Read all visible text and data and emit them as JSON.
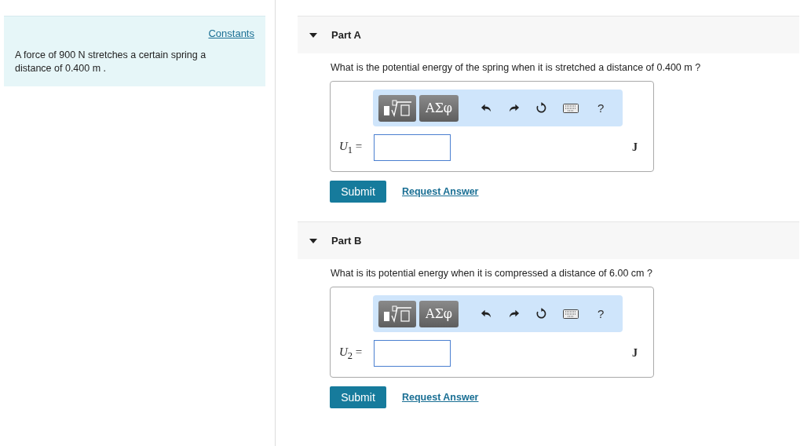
{
  "constants_link": "Constants",
  "problem": "A force of 900 N stretches a certain spring a distance of 0.400 m .",
  "parts": [
    {
      "title": "Part A",
      "expanded": true,
      "question": "What is the potential energy of the spring when it is stretched a distance of 0.400 m ?",
      "symbols_button": "ΑΣφ",
      "help_button": "?",
      "variable": "*U*$_{1}$ =",
      "unit": "J",
      "submit": "Submit",
      "request": "Request Answer"
    },
    {
      "title": "Part B",
      "expanded": true,
      "question": "What is its potential energy when it is compressed a distance of 6.00 cm ?",
      "symbols_button": "ΑΣφ",
      "help_button": "?",
      "variable": "*U*$_{2}$ =",
      "unit": "J",
      "submit": "Submit",
      "request": "Request Answer"
    }
  ]
}
